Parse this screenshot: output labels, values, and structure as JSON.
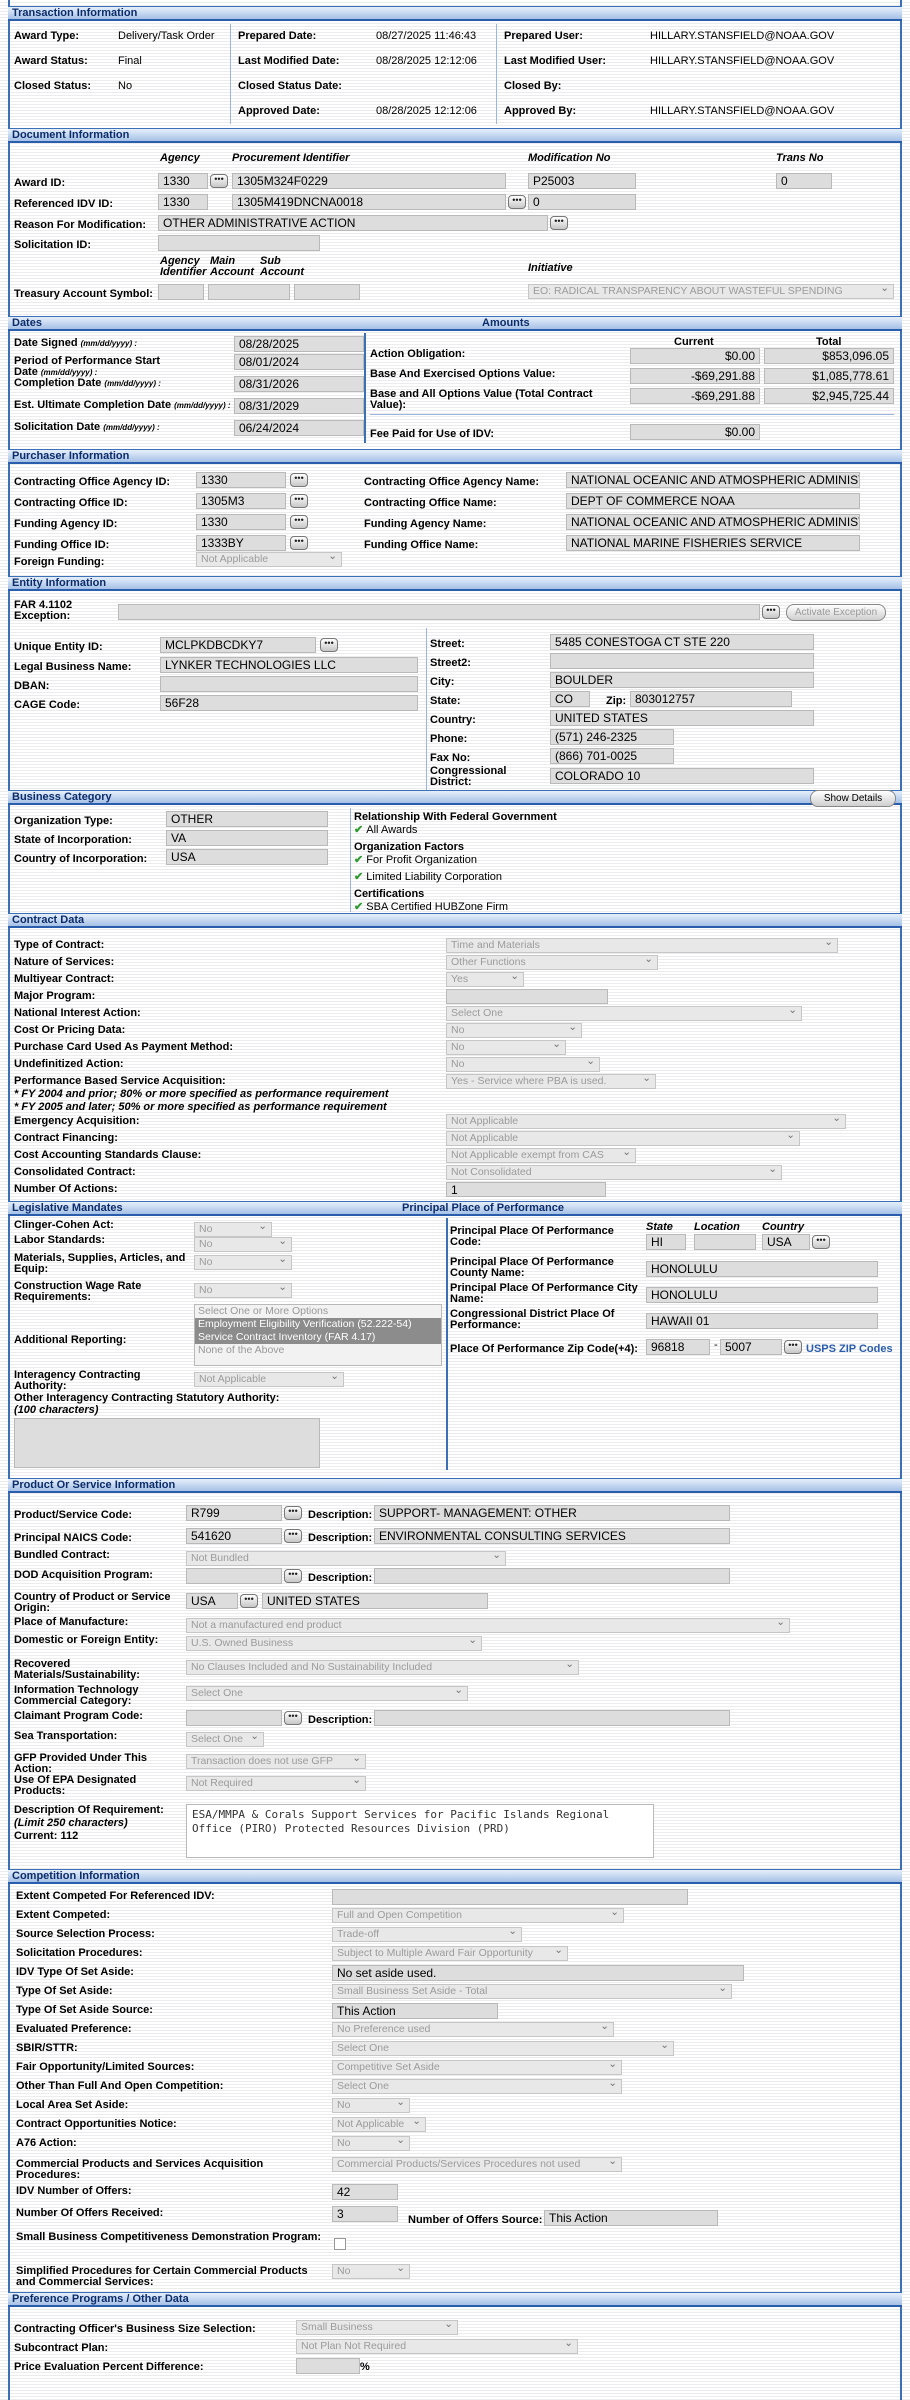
{
  "sections": {
    "transaction": "Transaction Information",
    "document": "Document Information",
    "dates": "Dates",
    "amounts": "Amounts",
    "purchaser": "Purchaser Information",
    "entity": "Entity Information",
    "business": "Business Category",
    "contract": "Contract Data",
    "legislative": "Legislative Mandates",
    "ppop": "Principal Place of Performance",
    "product": "Product Or Service Information",
    "competition": "Competition Information",
    "preference": "Preference Programs / Other Data"
  },
  "transaction": [
    {
      "label": "Award Type:",
      "value": "Delivery/Task Order"
    },
    {
      "label": "Award Status:",
      "value": "Final"
    },
    {
      "label": "Closed Status:",
      "value": "No"
    },
    {
      "label": "Prepared Date:",
      "value": "08/27/2025 11:46:43"
    },
    {
      "label": "Last Modified Date:",
      "value": "08/28/2025 12:12:06"
    },
    {
      "label": "Closed Status Date:",
      "value": ""
    },
    {
      "label": "Approved Date:",
      "value": "08/28/2025 12:12:06"
    },
    {
      "label": "Prepared User:",
      "value": "HILLARY.STANSFIELD@NOAA.GOV"
    },
    {
      "label": "Last Modified User:",
      "value": "HILLARY.STANSFIELD@NOAA.GOV"
    },
    {
      "label": "Closed By:",
      "value": ""
    },
    {
      "label": "Approved By:",
      "value": "HILLARY.STANSFIELD@NOAA.GOV"
    }
  ],
  "document": {
    "h_agency": "Agency",
    "h_proc": "Procurement Identifier",
    "h_mod": "Modification No",
    "h_trans": "Trans No",
    "award_id_label": "Award ID:",
    "award_agency": "1330",
    "award_proc": "1305M324F0229",
    "award_mod": "P25003",
    "award_trans": "0",
    "ref_label": "Referenced IDV ID:",
    "ref_agency": "1330",
    "ref_proc": "1305M419DNCNA0018",
    "ref_mod": "0",
    "reason_label": "Reason For Modification:",
    "reason": "OTHER ADMINISTRATIVE ACTION",
    "solicit_label": "Solicitation ID:",
    "h_agency_id": "Agency Identifier",
    "h_main": "Main Account",
    "h_sub": "Sub Account",
    "h_initiative": "Initiative",
    "treasury_label": "Treasury Account Symbol:",
    "initiative": "EO: RADICAL TRANSPARENCY ABOUT WASTEFUL SPENDING"
  },
  "dates": [
    {
      "label": "Date Signed",
      "fmt": "(mm/dd/yyyy) :",
      "value": "08/28/2025"
    },
    {
      "label": "Period of Performance Start Date",
      "fmt": "(mm/dd/yyyy) :",
      "value": "08/01/2024"
    },
    {
      "label": "Completion Date",
      "fmt": "(mm/dd/yyyy) :",
      "value": "08/31/2026"
    },
    {
      "label": "Est. Ultimate Completion Date",
      "fmt": "(mm/dd/yyyy) :",
      "value": "08/31/2029"
    },
    {
      "label": "Solicitation Date",
      "fmt": "(mm/dd/yyyy) :",
      "value": "06/24/2024"
    }
  ],
  "amounts": {
    "h_current": "Current",
    "h_total": "Total",
    "rows": [
      {
        "label": "Action Obligation:",
        "current": "$0.00",
        "total": "$853,096.05"
      },
      {
        "label": "Base And Exercised Options Value:",
        "current": "-$69,291.88",
        "total": "$1,085,778.61"
      },
      {
        "label": "Base and All Options Value (Total Contract Value):",
        "current": "-$69,291.88",
        "total": "$2,945,725.44"
      }
    ],
    "fee_label": "Fee Paid for Use of IDV:",
    "fee": "$0.00"
  },
  "purchaser": [
    {
      "label": "Contracting Office Agency ID:",
      "value": "1330",
      "rlabel": "Contracting Office Agency Name:",
      "rvalue": "NATIONAL OCEANIC AND ATMOSPHERIC ADMINISTRATION"
    },
    {
      "label": "Contracting Office ID:",
      "value": "1305M3",
      "rlabel": "Contracting Office Name:",
      "rvalue": "DEPT OF COMMERCE NOAA"
    },
    {
      "label": "Funding Agency ID:",
      "value": "1330",
      "rlabel": "Funding Agency Name:",
      "rvalue": "NATIONAL OCEANIC AND ATMOSPHERIC ADMINISTRATION"
    },
    {
      "label": "Funding Office ID:",
      "value": "1333BY",
      "rlabel": "Funding Office Name:",
      "rvalue": "NATIONAL MARINE FISHERIES SERVICE"
    }
  ],
  "purchaser_foreign": {
    "label": "Foreign Funding:",
    "value": "Not Applicable"
  },
  "entity": {
    "far_label": "FAR 4.1102 Exception:",
    "exception_btn": "Activate Exception",
    "uei_label": "Unique Entity ID:",
    "uei": "MCLPKDBCDKY7",
    "legal_label": "Legal Business Name:",
    "legal": "LYNKER TECHNOLOGIES LLC",
    "dba_label": "DBAN:",
    "cage_label": "CAGE Code:",
    "cage": "56F28",
    "street_label": "Street:",
    "street": "5485 CONESTOGA CT STE 220",
    "street2_label": "Street2:",
    "city_label": "City:",
    "city": "BOULDER",
    "state_label": "State:",
    "state": "CO",
    "zip_label": "Zip:",
    "zip": "803012757",
    "country_label": "Country:",
    "country": "UNITED STATES",
    "phone_label": "Phone:",
    "phone": "(571) 246-2325",
    "fax_label": "Fax No:",
    "fax": "(866) 701-0025",
    "cd_label": "Congressional District:",
    "cd": "COLORADO 10"
  },
  "business": {
    "details_btn": "Show Details",
    "org_label": "Organization Type:",
    "org": "OTHER",
    "state_label": "State of Incorporation:",
    "state": "VA",
    "country_label": "Country of Incorporation:",
    "country": "USA",
    "rel_title": "Relationship With Federal Government",
    "rel_items": [
      "All Awards"
    ],
    "org_title": "Organization Factors",
    "org_items": [
      "For Profit Organization",
      "Limited Liability Corporation"
    ],
    "cert_title": "Certifications",
    "cert_items": [
      "SBA Certified HUBZone Firm"
    ]
  },
  "contract": [
    {
      "label": "Type of Contract:",
      "value": "Time and Materials",
      "w": 392
    },
    {
      "label": "Nature of Services:",
      "value": "Other Functions",
      "w": 212
    },
    {
      "label": "Multiyear Contract:",
      "value": "Yes",
      "w": 78
    },
    {
      "label": "Major Program:",
      "value": "",
      "w": 162,
      "text": true
    },
    {
      "label": "National Interest Action:",
      "value": "Select One",
      "w": 356
    },
    {
      "label": "Cost Or Pricing Data:",
      "value": "No",
      "w": 136
    },
    {
      "label": "Purchase Card Used As Payment Method:",
      "value": "No",
      "w": 120
    },
    {
      "label": "Undefinitized Action:",
      "value": "No",
      "w": 154
    },
    {
      "label": "Performance Based Service Acquisition:",
      "value": "Yes - Service where PBA is used.",
      "w": 210
    }
  ],
  "contract_notes": [
    "* FY 2004 and prior; 80% or more specified as performance requirement",
    "* FY 2005 and later; 50% or more specified as performance requirement"
  ],
  "contract2": [
    {
      "label": "Emergency Acquisition:",
      "value": "Not Applicable",
      "w": 400
    },
    {
      "label": "Contract Financing:",
      "value": "Not Applicable",
      "w": 354
    },
    {
      "label": "Cost Accounting Standards Clause:",
      "value": "Not Applicable exempt from CAS",
      "w": 190
    },
    {
      "label": "Consolidated Contract:",
      "value": "Not Consolidated",
      "w": 336
    },
    {
      "label": "Number Of Actions:",
      "value": "1",
      "w": 160,
      "text": true
    }
  ],
  "legislative": {
    "rows": [
      {
        "label": "Clinger-Cohen Act:",
        "value": "No"
      },
      {
        "label": "Labor Standards:",
        "value": "No"
      },
      {
        "label": "Materials, Supplies, Articles, and Equip:",
        "value": "No"
      },
      {
        "label": "Construction Wage Rate Requirements:",
        "value": "No"
      }
    ],
    "addl_label": "Additional Reporting:",
    "addl_options": [
      "Select One or More Options",
      "Employment Eligibility Verification (52.222-54)",
      "Service Contract Inventory (FAR 4.17)",
      "None of the Above"
    ],
    "interagency_label": "Interagency Contracting Authority:",
    "interagency": "Not Applicable",
    "other_label": "Other Interagency Contracting Statutory Authority:",
    "other_hint": "(100 characters)"
  },
  "ppop": {
    "code_label": "Principal Place Of Performance Code:",
    "h_state": "State",
    "h_location": "Location",
    "h_country": "Country",
    "state": "HI",
    "country": "USA",
    "county_label": "Principal Place Of Performance County Name:",
    "county": "HONOLULU",
    "city_label": "Principal Place Of Performance City Name:",
    "city": "HONOLULU",
    "cd_label": "Congressional District Place Of Performance:",
    "cd": "HAWAII 01",
    "zip_label": "Place Of Performance Zip Code(+4):",
    "zip": "96818",
    "zip4": "5007",
    "zip_link": "USPS ZIP Codes"
  },
  "product": {
    "psc_label": "Product/Service Code:",
    "psc": "R799",
    "desc_label": "Description:",
    "psc_desc": "SUPPORT- MANAGEMENT: OTHER",
    "naics_label": "Principal NAICS Code:",
    "naics": "541620",
    "naics_desc": "ENVIRONMENTAL CONSULTING SERVICES",
    "rows": [
      {
        "label": "Bundled Contract:",
        "value": "Not Bundled",
        "w": 320
      },
      {
        "label": "DOD Acquisition Program:",
        "value": "",
        "w": 0
      },
      {
        "label": "Country of Product or Service Origin:",
        "value": "",
        "w": 0
      },
      {
        "label": "Place of Manufacture:",
        "value": "Not a manufactured end product",
        "w": 604
      },
      {
        "label": "Domestic or Foreign Entity:",
        "value": "U.S. Owned Business",
        "w": 296
      },
      {
        "label": "Recovered Materials/Sustainability:",
        "value": "No Clauses Included and No Sustainability Included",
        "w": 393
      },
      {
        "label": "Information Technology Commercial Category:",
        "value": "Select One",
        "w": 282
      },
      {
        "label": "Claimant Program Code:",
        "value": "",
        "w": 0
      },
      {
        "label": "Sea Transportation:",
        "value": "Select One",
        "w": 78
      },
      {
        "label": "GFP Provided Under This Action:",
        "value": "Transaction does not use GFP",
        "w": 180
      },
      {
        "label": "Use Of EPA Designated Products:",
        "value": "Not Required",
        "w": 180
      }
    ],
    "country": "USA",
    "country_name": "UNITED STATES",
    "req_label": "Description Of Requirement:",
    "req_hint": "(Limit 250 characters)",
    "req_current": "Current: 112",
    "req": "ESA/MMPA & Corals Support Services for Pacific Islands Regional Office (PIRO) Protected Resources Division (PRD)"
  },
  "competition": [
    {
      "label": "Extent Competed For Referenced IDV:",
      "value": "",
      "w": 356,
      "text": true
    },
    {
      "label": "Extent Competed:",
      "value": "Full and Open Competition",
      "w": 292
    },
    {
      "label": "Source Selection Process:",
      "value": "Trade-off",
      "w": 190
    },
    {
      "label": "Solicitation Procedures:",
      "value": "Subject to Multiple Award Fair Opportunity",
      "w": 236
    },
    {
      "label": "IDV Type Of Set Aside:",
      "value": "No set aside used.",
      "w": 412,
      "text": true
    },
    {
      "label": "Type Of Set Aside:",
      "value": "Small Business Set Aside - Total",
      "w": 400
    },
    {
      "label": "Type Of Set Aside Source:",
      "value": "This Action",
      "w": 166,
      "text": true
    },
    {
      "label": "Evaluated Preference:",
      "value": "No Preference used",
      "w": 282
    },
    {
      "label": "SBIR/STTR:",
      "value": "Select One",
      "w": 342
    },
    {
      "label": "Fair Opportunity/Limited Sources:",
      "value": "Competitive Set Aside",
      "w": 290
    },
    {
      "label": "Other Than Full And Open Competition:",
      "value": "Select One",
      "w": 290
    },
    {
      "label": "Local Area Set Aside:",
      "value": "No",
      "w": 78
    },
    {
      "label": "Contract Opportunities Notice:",
      "value": "Not Applicable",
      "w": 94
    },
    {
      "label": "A76 Action:",
      "value": "No",
      "w": 78
    },
    {
      "label": "Commercial Products and Services Acquisition Procedures:",
      "value": "Commercial Products/Services Procedures not used",
      "w": 290
    },
    {
      "label": "IDV Number of Offers:",
      "value": "42",
      "w": 66,
      "text": true
    },
    {
      "label": "Number Of Offers Received:",
      "value": "3",
      "w": 66,
      "text": true
    },
    {
      "label": "Small Business Competitiveness Demonstration Program:",
      "value": "",
      "w": 0
    },
    {
      "label": "Simplified Procedures for Certain Commercial Products and Commercial Services:",
      "value": "No",
      "w": 78
    }
  ],
  "offers_source": {
    "label": "Number of Offers Source:",
    "value": "This Action"
  },
  "preference": [
    {
      "label": "Contracting Officer's Business Size Selection:",
      "value": "Small Business",
      "w": 162
    },
    {
      "label": "Subcontract Plan:",
      "value": "Not Plan Not Required",
      "w": 282
    },
    {
      "label": "Price Evaluation Percent Difference:",
      "value": "",
      "w": 64,
      "text": true
    }
  ],
  "pct": "%",
  "icons": {
    "lookup": "ellipsis-icon",
    "check": "checkmark-icon"
  },
  "colors": {
    "header": "#a6c1e6",
    "header_text": "#0b2c6b",
    "border": "#3b6fb6",
    "check": "#2e9b2e"
  }
}
